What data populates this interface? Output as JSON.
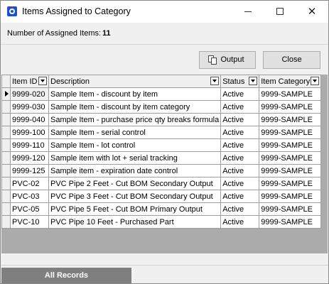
{
  "window": {
    "title": "Items Assigned to Category",
    "minimize": "",
    "maximize": "",
    "close": "✕"
  },
  "summary": {
    "label": "Number of Assigned Items:",
    "count": "11"
  },
  "toolbar": {
    "output_label": "Output",
    "close_label": "Close"
  },
  "grid": {
    "columns": [
      "Item ID",
      "Description",
      "Status",
      "Item Category"
    ],
    "rows": [
      [
        "9999-020",
        "Sample Item - discount by item",
        "Active",
        "9999-SAMPLE"
      ],
      [
        "9999-030",
        "Sample Item - discount by item category",
        "Active",
        "9999-SAMPLE"
      ],
      [
        "9999-040",
        "Sample Item - purchase price qty breaks formula",
        "Active",
        "9999-SAMPLE"
      ],
      [
        "9999-100",
        "Sample Item - serial control",
        "Active",
        "9999-SAMPLE"
      ],
      [
        "9999-110",
        "Sample Item - lot control",
        "Active",
        "9999-SAMPLE"
      ],
      [
        "9999-120",
        "Sample item with lot + serial tracking",
        "Active",
        "9999-SAMPLE"
      ],
      [
        "9999-125",
        "Sample item - expiration date control",
        "Active",
        "9999-SAMPLE"
      ],
      [
        "PVC-02",
        "PVC Pipe 2 Feet - Cut BOM Secondary Output",
        "Active",
        "9999-SAMPLE"
      ],
      [
        "PVC-03",
        "PVC Pipe 3 Feet - Cut BOM Secondary Output",
        "Active",
        "9999-SAMPLE"
      ],
      [
        "PVC-05",
        "PVC Pipe 5 Feet - Cut BOM Primary Output",
        "Active",
        "9999-SAMPLE"
      ],
      [
        "PVC-10",
        "PVC Pipe 10 Feet - Purchased Part",
        "Active",
        "9999-SAMPLE"
      ]
    ]
  },
  "status_tabs": {
    "all_records": "All Records"
  },
  "colors": {
    "tab_background": "#7f7f7f",
    "grid_background": "#ababab",
    "app_icon": "#1e4fd1"
  }
}
